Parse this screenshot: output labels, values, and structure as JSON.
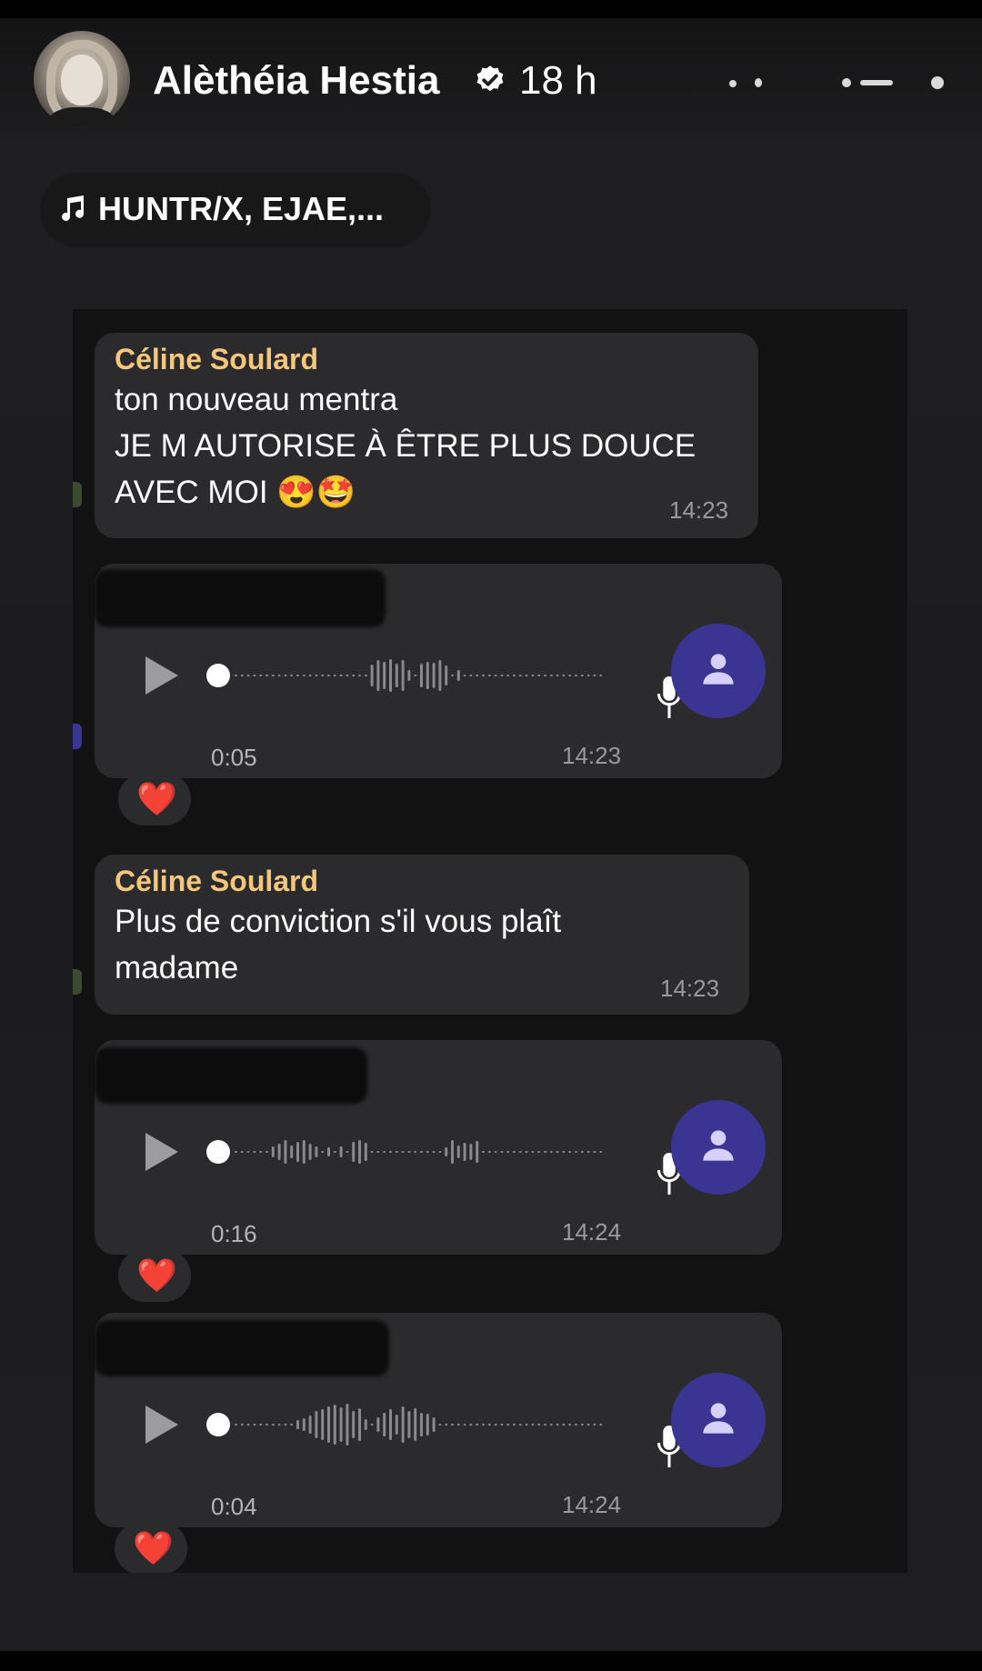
{
  "header": {
    "username": "Alèthéia Hestia",
    "time_ago": "18 h",
    "verified_icon": "verified-badge-icon",
    "menu_icon": "more-options-icon"
  },
  "music": {
    "icon": "music-note-icon",
    "label": "HUNTR/X, EJAE,..."
  },
  "chat": {
    "messages": [
      {
        "sender": "Céline Soulard",
        "text": "ton nouveau mentra\nJE M AUTORISE À ÊTRE PLUS DOUCE\nAVEC MOI 😍🤩",
        "time": "14:23"
      },
      {
        "type": "voice",
        "duration": "0:05",
        "time": "14:23",
        "reaction": "❤️"
      },
      {
        "sender": "Céline Soulard",
        "text": "Plus de conviction s'il vous plaît\nmadame",
        "time": "14:23"
      },
      {
        "type": "voice",
        "duration": "0:16",
        "time": "14:24",
        "reaction": "❤️"
      },
      {
        "type": "voice",
        "duration": "0:04",
        "time": "14:24",
        "reaction": "❤️"
      }
    ]
  },
  "colors": {
    "sender_name": "#f5c77a",
    "bubble": "#2b2b2d",
    "voice_avatar": "#3a3592",
    "reaction_heart": "#ff2d3a"
  }
}
